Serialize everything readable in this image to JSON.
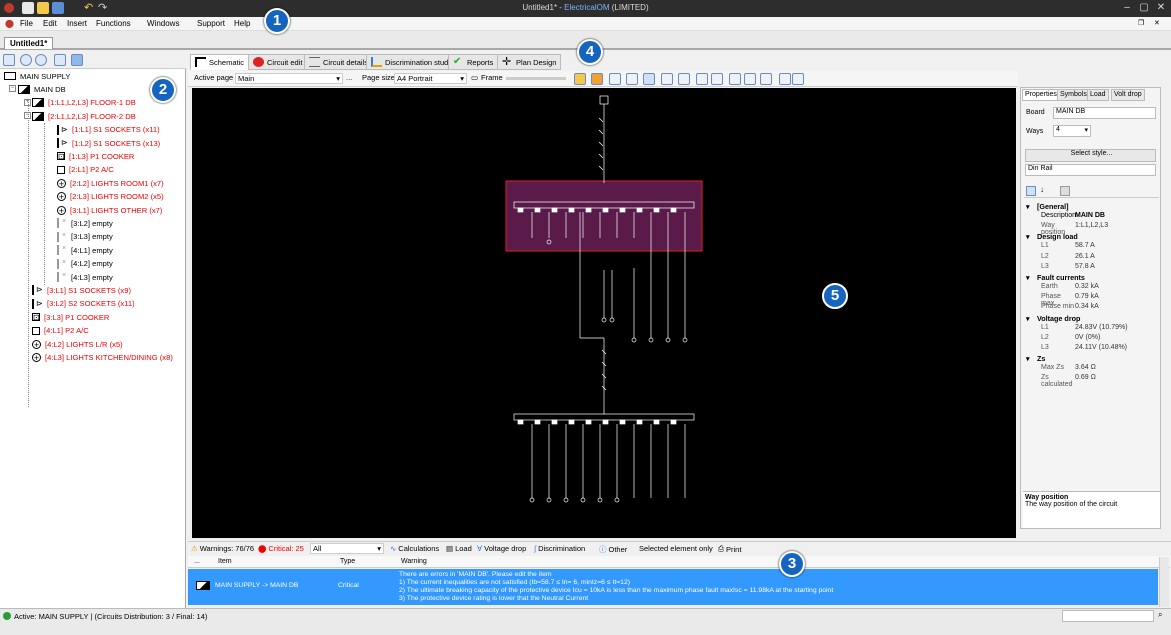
{
  "window": {
    "title_prefix": "Untitled1* - ",
    "title_app": "ElectricalOM",
    "title_suffix": " (LIMITED)"
  },
  "menu": [
    "File",
    "Edit",
    "Insert",
    "Functions",
    "Windows",
    "Support",
    "Help"
  ],
  "doc_tab": "Untitled1*",
  "tree": [
    {
      "label": "MAIN SUPPLY",
      "level": 0,
      "red": false,
      "sym": "supply"
    },
    {
      "label": "MAIN DB",
      "level": 1,
      "red": false,
      "sym": "db"
    },
    {
      "label": "[1:L1,L2,L3] FLOOR-1 DB",
      "level": 2,
      "red": true,
      "sym": "db"
    },
    {
      "label": "[2:L1,L2,L3] FLOOR-2 DB",
      "level": 2,
      "red": true,
      "sym": "db"
    },
    {
      "label": "[1:L1] S1 SOCKETS (x11)",
      "level": 3,
      "red": true,
      "sym": "sock"
    },
    {
      "label": "[1:L2] S1 SOCKETS (x13)",
      "level": 3,
      "red": true,
      "sym": "sock"
    },
    {
      "label": "[1:L3] P1 COOKER",
      "level": 3,
      "red": true,
      "sym": "cook"
    },
    {
      "label": "[2:L1] P2 A/C",
      "level": 3,
      "red": true,
      "sym": "box"
    },
    {
      "label": "[2:L2] LIGHTS ROOM1 (x7)",
      "level": 3,
      "red": true,
      "sym": "light"
    },
    {
      "label": "[2:L3] LIGHTS ROOM2 (x5)",
      "level": 3,
      "red": true,
      "sym": "light"
    },
    {
      "label": "[3:L1] LIGHTS OTHER (x7)",
      "level": 3,
      "red": true,
      "sym": "light"
    },
    {
      "label": "[3:L2] empty",
      "level": 3,
      "red": false,
      "sym": "empty"
    },
    {
      "label": "[3:L3] empty",
      "level": 3,
      "red": false,
      "sym": "empty"
    },
    {
      "label": "[4:L1] empty",
      "level": 3,
      "red": false,
      "sym": "empty"
    },
    {
      "label": "[4:L2] empty",
      "level": 3,
      "red": false,
      "sym": "empty"
    },
    {
      "label": "[4:L3] empty",
      "level": 3,
      "red": false,
      "sym": "empty"
    },
    {
      "label": "[3:L1] S1 SOCKETS (x9)",
      "level": 2,
      "red": true,
      "sym": "sock"
    },
    {
      "label": "[3:L2] S2 SOCKETS (x11)",
      "level": 2,
      "red": true,
      "sym": "sock"
    },
    {
      "label": "[3:L3] P1 COOKER",
      "level": 2,
      "red": true,
      "sym": "cook"
    },
    {
      "label": "[4:L1] P2 A/C",
      "level": 2,
      "red": true,
      "sym": "box"
    },
    {
      "label": "[4:L2] LIGHTS L/R (x5)",
      "level": 2,
      "red": true,
      "sym": "light"
    },
    {
      "label": "[4:L3] LIGHTS KITCHEN/DINING (x8)",
      "level": 2,
      "red": true,
      "sym": "light"
    }
  ],
  "view_tabs": [
    "Schematic",
    "Circuit edit",
    "Circuit details",
    "Discrimination study",
    "Reports",
    "Plan Design"
  ],
  "pagebar": {
    "active_page_label": "Active page",
    "active_page_value": "Main",
    "more": "...",
    "page_size_label": "Page size",
    "page_size_value": "A4 Portrait",
    "frame_label": "Frame"
  },
  "right": {
    "tabs": [
      "Properties",
      "Symbols",
      "Load",
      "Volt drop"
    ],
    "board_label": "Board",
    "board_value": "MAIN DB",
    "ways_label": "Ways",
    "ways_value": "4",
    "style_button": "Select style...",
    "din_rail": "Din Rail",
    "groups": [
      {
        "name": "[General]",
        "rows": [
          [
            "Description",
            "MAIN DB"
          ],
          [
            "Way position",
            "1:L1,L2,L3"
          ]
        ]
      },
      {
        "name": "Design load",
        "rows": [
          [
            "L1",
            "58.7 A"
          ],
          [
            "L2",
            "26.1 A"
          ],
          [
            "L3",
            "57.8 A"
          ]
        ]
      },
      {
        "name": "Fault currents",
        "rows": [
          [
            "Earth",
            "0.32 kA"
          ],
          [
            "Phase max",
            "0.79 kA"
          ],
          [
            "Phase min",
            "0.34 kA"
          ]
        ]
      },
      {
        "name": "Voltage drop",
        "rows": [
          [
            "L1",
            "24.83V (10.79%)"
          ],
          [
            "L2",
            "0V (0%)"
          ],
          [
            "L3",
            "24.11V (10.48%)"
          ]
        ]
      },
      {
        "name": "Zs",
        "rows": [
          [
            "Max Zs",
            "3.64 Ω"
          ],
          [
            "Zs calculated",
            "0.69 Ω"
          ]
        ]
      }
    ],
    "desc_title": "Way position",
    "desc_text": "The way position of the circuit"
  },
  "warnbar": {
    "warnings": "Warnings: 76/76",
    "critical": "Critical: 25",
    "filter": "All",
    "calc": "Calculations",
    "load": "Load",
    "vdrop": "Voltage drop",
    "disc": "Discrimination",
    "other": "Other",
    "selected": "Selected element only",
    "print": "Print"
  },
  "warn_headers": [
    "...",
    "Item",
    "Type",
    "Warning"
  ],
  "warn_row": {
    "item": "MAIN SUPPLY -> MAIN DB",
    "type": "Critical",
    "lines": [
      "There are errors in 'MAIN DB'. Please edit the item",
      "1) The current inequalities are not satisfied (Ib=58.7  ≤  In= 6, minIz=6  ≤  It=12)",
      "2) The ultimate breaking capacity of the protective device Icu = 10kA is less than the maximum phase fault maxIsc = 11.98kA at the starting point",
      "3) The protective device rating is lower that the Neutral Current"
    ]
  },
  "status": "Active: MAIN SUPPLY | (Circuits Distribution: 3 / Final: 14)",
  "badges": [
    "1",
    "2",
    "3",
    "4",
    "5"
  ],
  "colors": {
    "accent": "#1565c0",
    "selection": "#3399ff",
    "error": "#e00000",
    "highlight_box": "#5a1a4a"
  }
}
